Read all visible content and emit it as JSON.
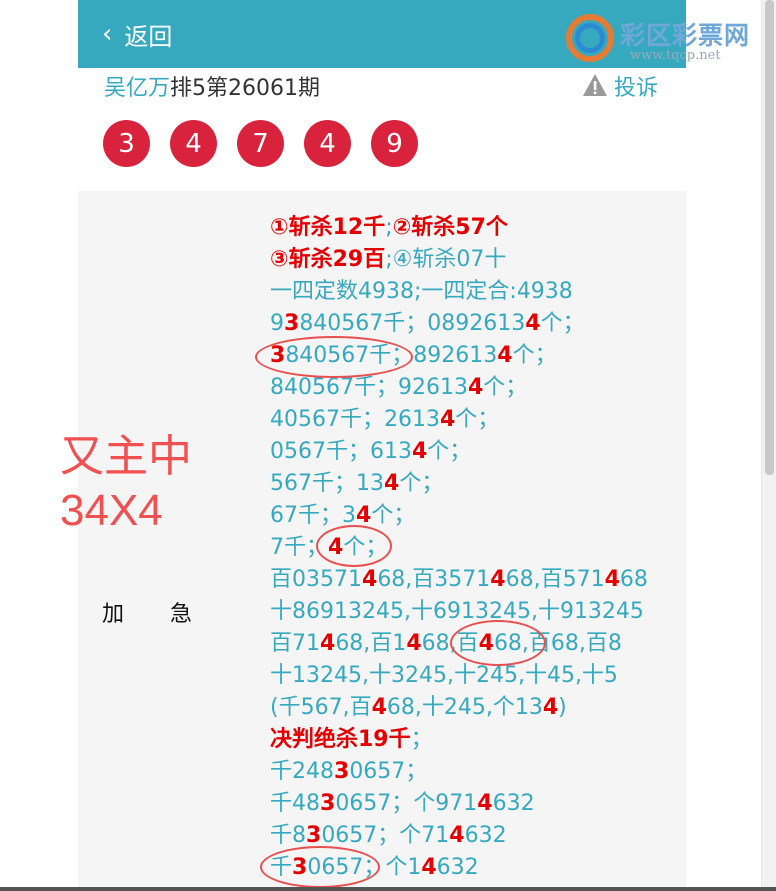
{
  "header": {
    "back_label": "返回",
    "logo_name": "彩区彩票网",
    "logo_url": "www.tqcp.net"
  },
  "post": {
    "author": "吴亿万",
    "issue": "排5第26061期",
    "complain_label": "投诉"
  },
  "balls": [
    "3",
    "4",
    "7",
    "4",
    "9"
  ],
  "overlay": {
    "line1": "又主中",
    "line2": "34X4"
  },
  "urgent": {
    "a": "加",
    "b": "急"
  },
  "lines": [
    [
      [
        "①斩杀12千",
        "rb"
      ],
      [
        ";",
        "n"
      ],
      [
        "②斩杀57个",
        "rb"
      ]
    ],
    [
      [
        "③斩杀29百",
        "rb"
      ],
      [
        ";④斩杀07十",
        "n"
      ]
    ],
    [
      [
        "一四定数4938;一四定合:4938",
        "n"
      ]
    ],
    [
      [
        "9",
        "n"
      ],
      [
        "3",
        "r"
      ],
      [
        "840567千；0892613",
        "n"
      ],
      [
        "4",
        "r"
      ],
      [
        "个；",
        "n"
      ]
    ],
    [
      [
        "3",
        "r"
      ],
      [
        "840567千；892613",
        "n"
      ],
      [
        "4",
        "r"
      ],
      [
        "个；",
        "n"
      ]
    ],
    [
      [
        "840567千；92613",
        "n"
      ],
      [
        "4",
        "r"
      ],
      [
        "个；",
        "n"
      ]
    ],
    [
      [
        "40567千；2613",
        "n"
      ],
      [
        "4",
        "r"
      ],
      [
        "个；",
        "n"
      ]
    ],
    [
      [
        "0567千；613",
        "n"
      ],
      [
        "4",
        "r"
      ],
      [
        "个；",
        "n"
      ]
    ],
    [
      [
        "567千；13",
        "n"
      ],
      [
        "4",
        "r"
      ],
      [
        "个；",
        "n"
      ]
    ],
    [
      [
        "67千；3",
        "n"
      ],
      [
        "4",
        "r"
      ],
      [
        "个；",
        "n"
      ]
    ],
    [
      [
        "7千；",
        "n"
      ],
      [
        "4",
        "r"
      ],
      [
        "个；",
        "n"
      ]
    ],
    [
      [
        "百03571",
        "n"
      ],
      [
        "4",
        "r"
      ],
      [
        "68,百3571",
        "n"
      ],
      [
        "4",
        "r"
      ],
      [
        "68,百571",
        "n"
      ],
      [
        "4",
        "r"
      ],
      [
        "68",
        "n"
      ]
    ],
    [
      [
        "十86913245,十6913245,十913245",
        "n"
      ]
    ],
    [
      [
        "百71",
        "n"
      ],
      [
        "4",
        "r"
      ],
      [
        "68,百1",
        "n"
      ],
      [
        "4",
        "r"
      ],
      [
        "68,百",
        "n"
      ],
      [
        "4",
        "r"
      ],
      [
        "68,百68,百8",
        "n"
      ]
    ],
    [
      [
        "十13245,十3245,十245,十45,十5",
        "n"
      ]
    ],
    [
      [
        "(千567,百",
        "n"
      ],
      [
        "4",
        "r"
      ],
      [
        "68,十245,个13",
        "n"
      ],
      [
        "4",
        "r"
      ],
      [
        ")",
        "n"
      ]
    ],
    [
      [
        "决判绝杀19千",
        "rb"
      ],
      [
        "；",
        "n"
      ]
    ],
    [
      [
        "千248",
        "n"
      ],
      [
        "3",
        "r"
      ],
      [
        "0657；",
        "n"
      ]
    ],
    [
      [
        "千48",
        "n"
      ],
      [
        "3",
        "r"
      ],
      [
        "0657；个971",
        "n"
      ],
      [
        "4",
        "r"
      ],
      [
        "632",
        "n"
      ]
    ],
    [
      [
        "千8",
        "n"
      ],
      [
        "3",
        "r"
      ],
      [
        "0657；个71",
        "n"
      ],
      [
        "4",
        "r"
      ],
      [
        "632",
        "n"
      ]
    ],
    [
      [
        "千",
        "n"
      ],
      [
        "3",
        "r"
      ],
      [
        "0657；个1",
        "n"
      ],
      [
        "4",
        "r"
      ],
      [
        "632",
        "n"
      ]
    ]
  ]
}
